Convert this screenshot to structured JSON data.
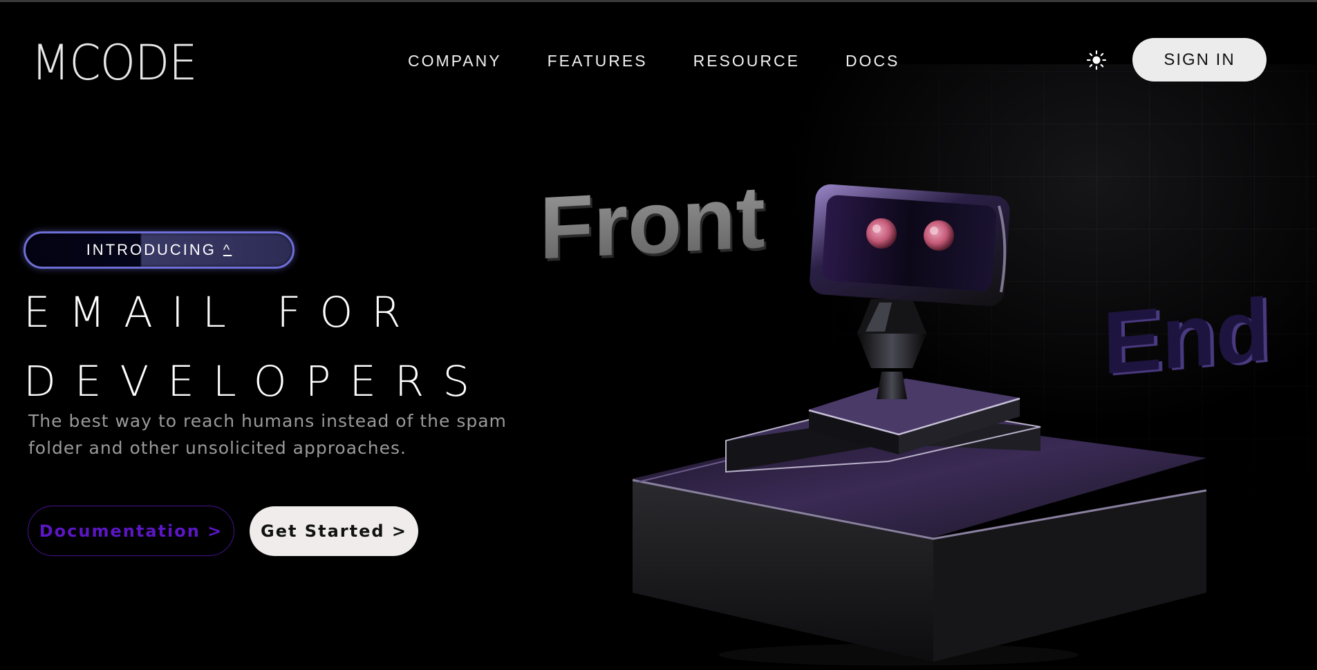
{
  "header": {
    "logo": "MCODE",
    "nav": [
      "COMPANY",
      "FEATURES",
      "RESOURCE",
      "DOCS"
    ],
    "theme_toggle_icon": "sun-icon",
    "sign_in_label": "SIGN IN"
  },
  "hero": {
    "badge_label": "INTRODUCING",
    "badge_icon": "^",
    "headline_line1": "EMAIL FOR",
    "headline_line2": "DEVELOPERS",
    "subtext": "The best way to reach humans instead of the spam folder and other unsolicited approaches.",
    "docs_button_label": "Documentation >",
    "start_button_label": "Get Started >"
  },
  "illustration": {
    "word_left": "Front",
    "word_right": "End",
    "icon": "robot-illustration"
  },
  "colors": {
    "background": "#000000",
    "accent_purple": "#5c16c6",
    "badge_border": "#6f6fd8",
    "button_light": "#ececec"
  }
}
